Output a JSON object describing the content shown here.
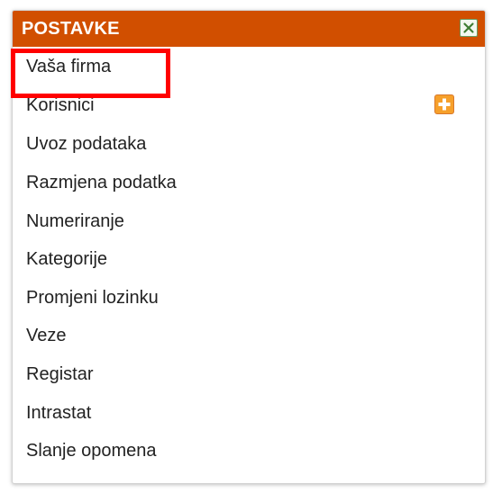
{
  "header": {
    "title": "POSTAVKE",
    "close_icon": "close-icon"
  },
  "menu": {
    "items": [
      {
        "label": "Vaša firma",
        "highlighted": true
      },
      {
        "label": "Korisnici",
        "action_icon": "add-icon"
      },
      {
        "label": "Uvoz podataka"
      },
      {
        "label": "Razmjena podatka"
      },
      {
        "label": "Numeriranje"
      },
      {
        "label": "Kategorije"
      },
      {
        "label": "Promjeni lozinku"
      },
      {
        "label": "Veze"
      },
      {
        "label": "Registar"
      },
      {
        "label": "Intrastat"
      },
      {
        "label": "Slanje opomena"
      }
    ]
  },
  "colors": {
    "header_bg": "#d14f00",
    "highlight_border": "#ff0000",
    "add_icon": "#f6a02b"
  }
}
